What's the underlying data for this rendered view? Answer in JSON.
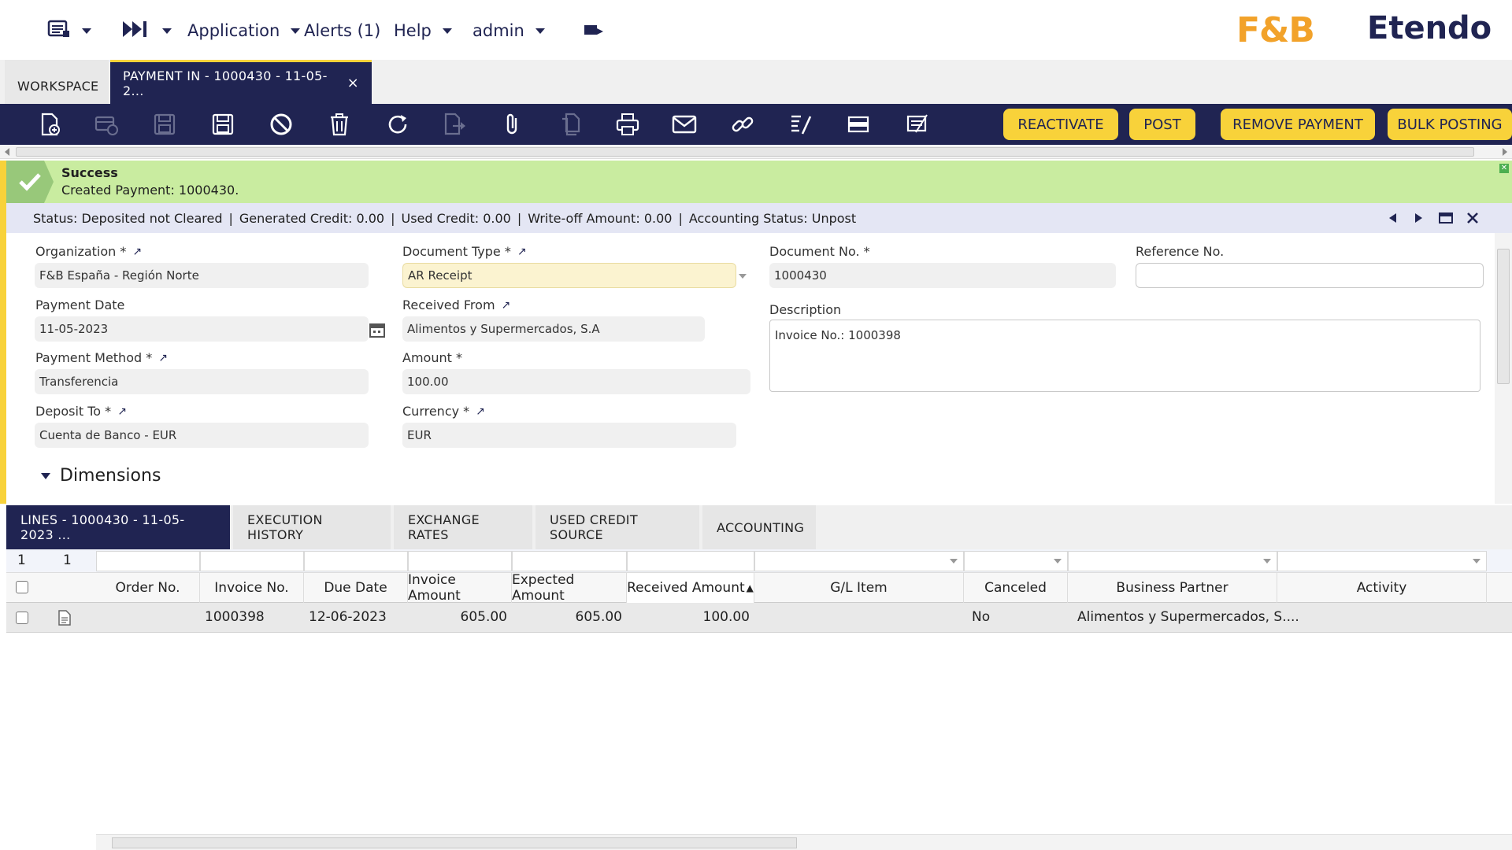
{
  "nav": {
    "application": "Application",
    "alerts": "Alerts (1)",
    "help": "Help",
    "user": "admin"
  },
  "brand": {
    "fb_logo": "F&B",
    "etendo_logo": "Etendo",
    "accent_color": "#f8d23a",
    "primary_color": "#202452"
  },
  "tabs": {
    "workspace": "WORKSPACE",
    "active": "PAYMENT IN - 1000430 - 11-05-2...",
    "close": "×"
  },
  "toolbar": {
    "icons": [
      "new-document-icon",
      "new-row-icon",
      "save-icon",
      "save-close-icon",
      "cancel-icon",
      "delete-icon",
      "refresh-icon",
      "export-icon",
      "attach-icon",
      "clone-icon",
      "print-icon",
      "email-icon",
      "link-icon",
      "audit-icon",
      "toggle-view-icon",
      "form-icon"
    ],
    "reactivate": "REACTIVATE",
    "post": "POST",
    "remove_payment": "REMOVE PAYMENT",
    "bulk_posting": "BULK POSTING"
  },
  "message": {
    "title": "Success",
    "text": "Created Payment: 1000430."
  },
  "status": {
    "status_label": "Status:",
    "status_value": "Deposited not Cleared",
    "generated_credit_label": "Generated Credit:",
    "generated_credit_value": "0.00",
    "used_credit_label": "Used Credit:",
    "used_credit_value": "0.00",
    "writeoff_label": "Write-off Amount:",
    "writeoff_value": "0.00",
    "accounting_label": "Accounting Status:",
    "accounting_value": "Unpost"
  },
  "form": {
    "organization_label": "Organization *",
    "organization_value": "F&B España - Región Norte",
    "document_type_label": "Document Type *",
    "document_type_value": "AR Receipt",
    "document_no_label": "Document No. *",
    "document_no_value": "1000430",
    "reference_no_label": "Reference No.",
    "reference_no_value": "",
    "payment_date_label": "Payment Date",
    "payment_date_value": "11-05-2023",
    "received_from_label": "Received From",
    "received_from_value": "Alimentos y Supermercados, S.A",
    "description_label": "Description",
    "description_value": "Invoice No.: 1000398",
    "payment_method_label": "Payment Method *",
    "payment_method_value": "Transferencia",
    "amount_label": "Amount *",
    "amount_value": "100.00",
    "deposit_to_label": "Deposit To *",
    "deposit_to_value": "Cuenta de Banco - EUR",
    "currency_label": "Currency *",
    "currency_value": "EUR",
    "dimensions": "Dimensions"
  },
  "subtabs": {
    "lines": "LINES - 1000430 - 11-05-2023 ...",
    "execution_history": "EXECUTION HISTORY",
    "exchange_rates": "EXCHANGE RATES",
    "used_credit_source": "USED CREDIT SOURCE",
    "accounting": "ACCOUNTING"
  },
  "grid": {
    "filter_count_a": "1",
    "filter_count_b": "1",
    "columns": [
      "Order No.",
      "Invoice No.",
      "Due Date",
      "Invoice Amount",
      "Expected Amount",
      "Received Amount",
      "G/L Item",
      "Canceled",
      "Business Partner",
      "Activity"
    ],
    "sort_indicator": "▲",
    "rows": [
      {
        "order_no": "",
        "invoice_no": "1000398",
        "due_date": "12-06-2023",
        "invoice_amount": "605.00",
        "expected_amount": "605.00",
        "received_amount": "100.00",
        "gl_item": "",
        "canceled": "No",
        "business_partner": "Alimentos y Supermercados, S....",
        "activity": ""
      }
    ]
  }
}
